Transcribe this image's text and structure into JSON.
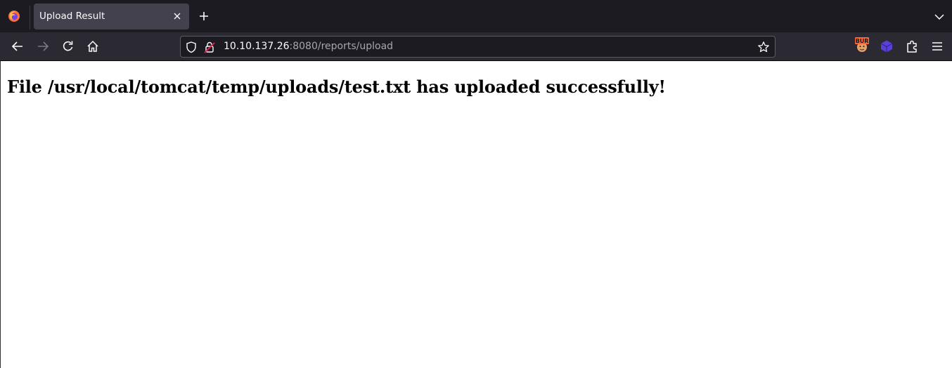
{
  "browser": {
    "tab": {
      "title": "Upload Result"
    },
    "url": {
      "host": "10.10.137.26",
      "rest": ":8080/reports/upload"
    },
    "extensions": {
      "burp_label": "BUR"
    }
  },
  "page": {
    "heading": "File /usr/local/tomcat/temp/uploads/test.txt has uploaded successfully!"
  }
}
